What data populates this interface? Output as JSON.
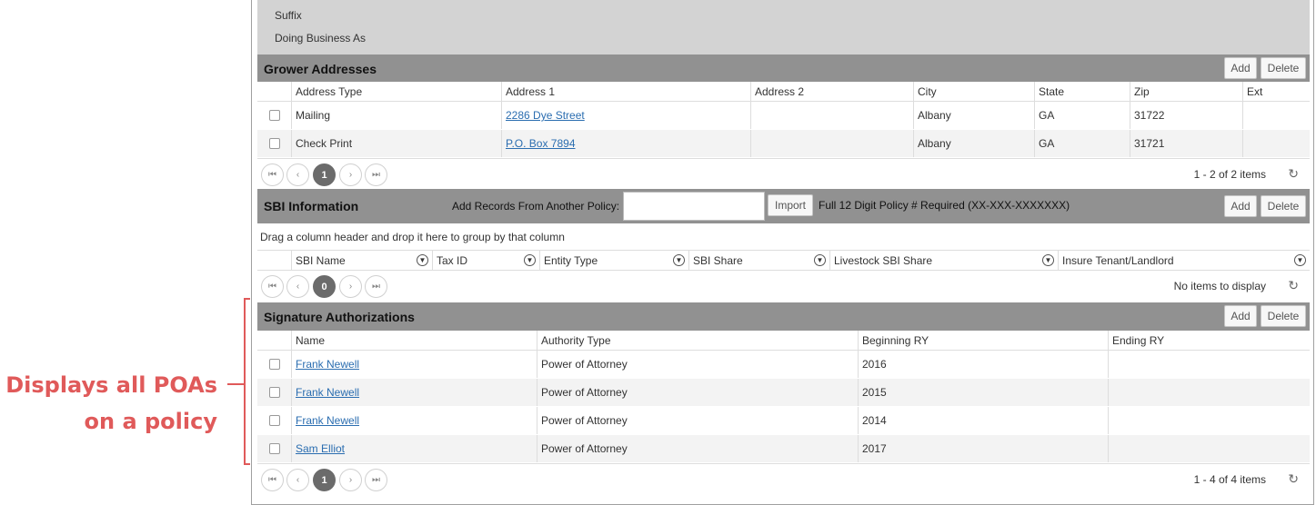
{
  "annotation": {
    "line1": "Displays all POAs",
    "line2": "on a policy"
  },
  "top": {
    "suffix_label": "Suffix",
    "dba_label": "Doing Business As"
  },
  "addresses": {
    "title": "Grower Addresses",
    "add_label": "Add",
    "delete_label": "Delete",
    "columns": [
      "Address Type",
      "Address 1",
      "Address 2",
      "City",
      "State",
      "Zip",
      "Ext"
    ],
    "rows": [
      {
        "type": "Mailing",
        "addr1": "2286 Dye Street",
        "addr2": "",
        "city": "Albany",
        "state": "GA",
        "zip": "31722",
        "ext": ""
      },
      {
        "type": "Check Print",
        "addr1": "P.O. Box 7894",
        "addr2": "",
        "city": "Albany",
        "state": "GA",
        "zip": "31721",
        "ext": ""
      }
    ],
    "pager": {
      "page": "1",
      "info": "1 - 2 of 2 items"
    }
  },
  "sbi": {
    "title": "SBI Information",
    "add_records_label": "Add Records From Another Policy:",
    "policy_input_value": "",
    "import_label": "Import",
    "policy_hint": "Full 12 Digit Policy # Required (XX-XXX-XXXXXXX)",
    "add_label": "Add",
    "delete_label": "Delete",
    "group_hint": "Drag a column header and drop it here to group by that column",
    "columns": [
      "SBI Name",
      "Tax ID",
      "Entity Type",
      "SBI Share",
      "Livestock SBI Share",
      "Insure Tenant/Landlord"
    ],
    "pager": {
      "page": "0",
      "info": "No items to display"
    }
  },
  "signatures": {
    "title": "Signature Authorizations",
    "add_label": "Add",
    "delete_label": "Delete",
    "columns": [
      "Name",
      "Authority Type",
      "Beginning RY",
      "Ending RY"
    ],
    "rows": [
      {
        "name": "Frank Newell",
        "authority": "Power of Attorney",
        "begin": "2016",
        "end": ""
      },
      {
        "name": "Frank Newell",
        "authority": "Power of Attorney",
        "begin": "2015",
        "end": ""
      },
      {
        "name": "Frank Newell",
        "authority": "Power of Attorney",
        "begin": "2014",
        "end": ""
      },
      {
        "name": "Sam Elliot",
        "authority": "Power of Attorney",
        "begin": "2017",
        "end": ""
      }
    ],
    "pager": {
      "page": "1",
      "info": "1 - 4 of 4 items"
    }
  },
  "pager_icons": {
    "first": "⏮",
    "prev": "‹",
    "next": "›",
    "last": "⏭",
    "refresh": "↻"
  },
  "colors": {
    "header_bg": "#919191",
    "top_bg": "#d3d3d3",
    "link": "#2a6db0",
    "annotation": "#e05a5a"
  }
}
